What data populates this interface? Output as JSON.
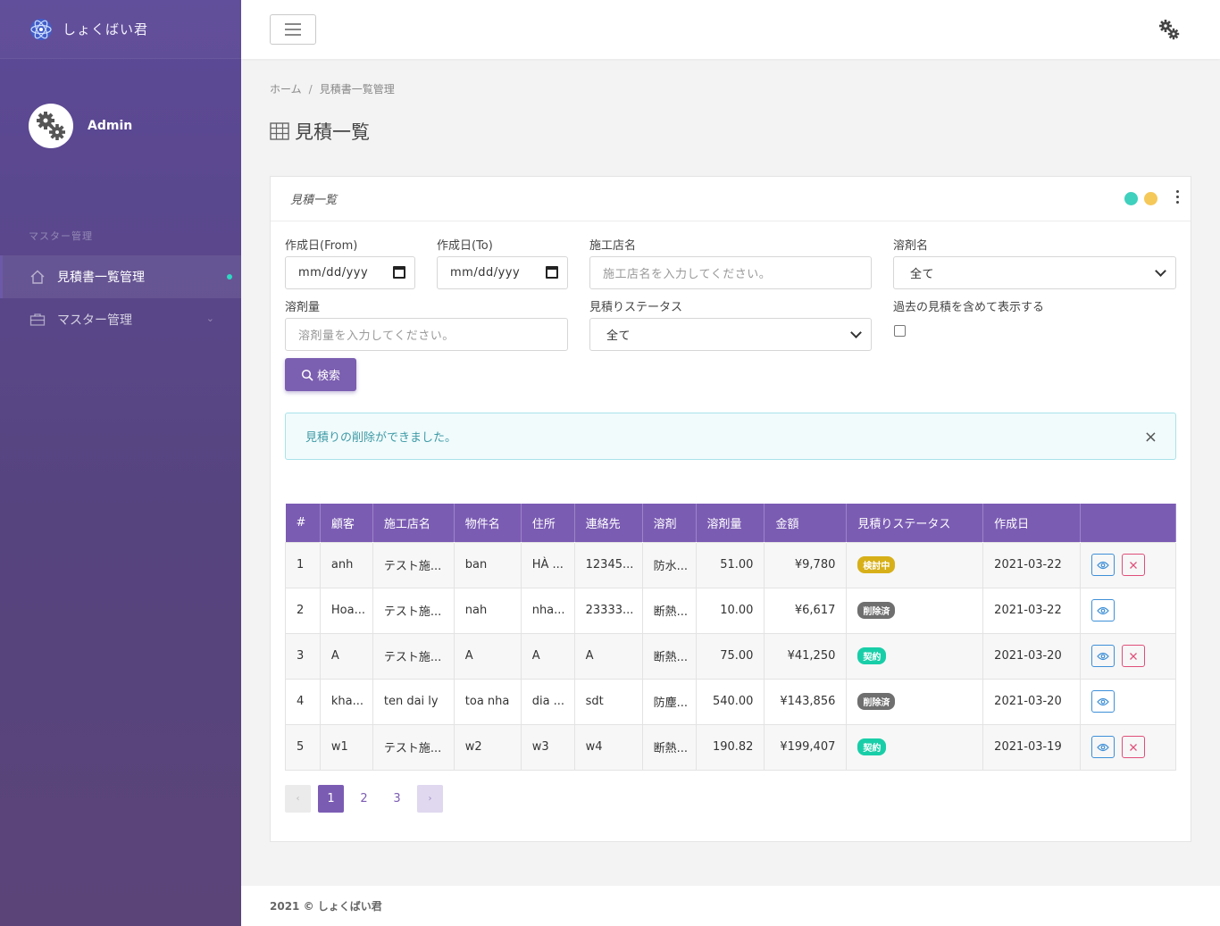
{
  "app": {
    "name": "しょくばい君"
  },
  "profile": {
    "name": "Admin"
  },
  "sidebar": {
    "section": "マスター管理",
    "items": [
      {
        "label": "見積書一覧管理",
        "icon": "home-icon",
        "active": true
      },
      {
        "label": "マスター管理",
        "icon": "briefcase-icon",
        "active": false
      }
    ]
  },
  "breadcrumb": {
    "home": "ホーム",
    "separator": "/",
    "current": "見積書一覧管理"
  },
  "page": {
    "title": "見積一覧"
  },
  "card": {
    "title": "見積一覧"
  },
  "filters": {
    "date_from_label": "作成日(From)",
    "date_from_value": "mm/dd/yyy",
    "date_to_label": "作成日(To)",
    "date_to_value": "mm/dd/yyy",
    "shop_label": "施工店名",
    "shop_placeholder": "施工店名を入力してください。",
    "solvent_label": "溶剤名",
    "solvent_value": "全て",
    "amount_label": "溶剤量",
    "amount_placeholder": "溶剤量を入力してください。",
    "status_label": "見積りステータス",
    "status_value": "全て",
    "past_label": "過去の見積を含めて表示する",
    "search_label": "検索"
  },
  "alert": {
    "message": "見積りの削除ができました。",
    "close": "×"
  },
  "table": {
    "headers": [
      "#",
      "顧客",
      "施工店名",
      "物件名",
      "住所",
      "連絡先",
      "溶剤",
      "溶剤量",
      "金額",
      "見積りステータス",
      "作成日",
      ""
    ],
    "rows": [
      {
        "no": "1",
        "customer": "anh",
        "shop": "テスト施...",
        "property": "ban",
        "address": "HÀ ...",
        "contact": "12345...",
        "solvent": "防水...",
        "amount": "51.00",
        "price": "¥9,780",
        "status": "検討中",
        "status_color": "yellow",
        "date": "2021-03-22",
        "deletable": true
      },
      {
        "no": "2",
        "customer": "Hoa...",
        "shop": "テスト施...",
        "property": "nah",
        "address": "nha...",
        "contact": "23333...",
        "solvent": "断熱...",
        "amount": "10.00",
        "price": "¥6,617",
        "status": "削除済",
        "status_color": "gray",
        "date": "2021-03-22",
        "deletable": false
      },
      {
        "no": "3",
        "customer": "A",
        "shop": "テスト施...",
        "property": "A",
        "address": "A",
        "contact": "A",
        "solvent": "断熱...",
        "amount": "75.00",
        "price": "¥41,250",
        "status": "契約",
        "status_color": "green",
        "date": "2021-03-20",
        "deletable": true
      },
      {
        "no": "4",
        "customer": "kha...",
        "shop": "ten dai ly",
        "property": "toa nha",
        "address": "dia ...",
        "contact": "sdt",
        "solvent": "防塵...",
        "amount": "540.00",
        "price": "¥143,856",
        "status": "削除済",
        "status_color": "gray",
        "date": "2021-03-20",
        "deletable": false
      },
      {
        "no": "5",
        "customer": "w1",
        "shop": "テスト施...",
        "property": "w2",
        "address": "w3",
        "contact": "w4",
        "solvent": "断熱...",
        "amount": "190.82",
        "price": "¥199,407",
        "status": "契約",
        "status_color": "green",
        "date": "2021-03-19",
        "deletable": true
      }
    ]
  },
  "pagination": {
    "prev": "‹",
    "pages": [
      "1",
      "2",
      "3"
    ],
    "current": "1",
    "next": "›"
  },
  "footer": {
    "text": "2021 © しょくばい君"
  },
  "colors": {
    "primary": "#7b5cb3",
    "sidebar": "#5d4a98",
    "alert_text": "#3e9aa6"
  }
}
